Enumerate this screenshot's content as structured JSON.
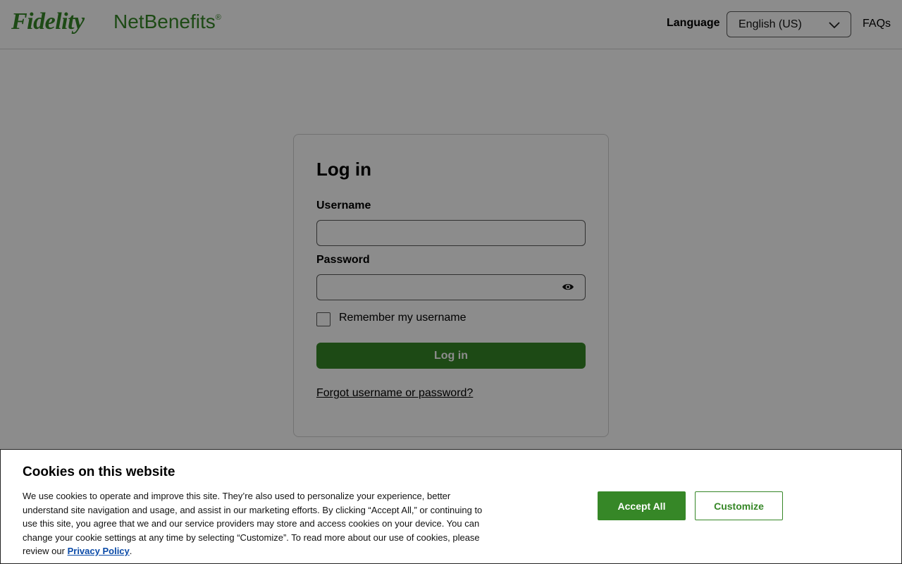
{
  "header": {
    "logo_primary": "Fidelity",
    "logo_secondary": "NetBenefits",
    "logo_mark": "®",
    "language_label": "Language",
    "language_value": "English (US)",
    "faqs_label": "FAQs",
    "icons": {
      "language_dropdown": "chevron-down-icon"
    }
  },
  "login": {
    "title": "Log in",
    "username_label": "Username",
    "username_value": "",
    "password_label": "Password",
    "password_value": "",
    "remember_label": "Remember my username",
    "remember_checked": false,
    "submit_label": "Log in",
    "forgot_label": "Forgot username or password?",
    "icons": {
      "password_toggle": "eye-icon"
    }
  },
  "cookie_banner": {
    "title": "Cookies on this website",
    "body": "We use cookies to operate and improve this site. They’re also used to personalize your experience, better understand site navigation and usage, and assist in our marketing efforts. By clicking “Accept All,” or continuing to use this site, you agree that we and our service providers may store and access cookies on your device. You can change your cookie settings at any time by selecting “Customize”. To read more about our use of cookies, please review our",
    "privacy_link": "Privacy Policy",
    "trailing": ".",
    "accept_label": "Accept All",
    "customize_label": "Customize"
  },
  "colors": {
    "brand_green": "#368727",
    "overlay": "rgba(0,0,0,0.45)",
    "link_blue": "#0a4aa8"
  }
}
